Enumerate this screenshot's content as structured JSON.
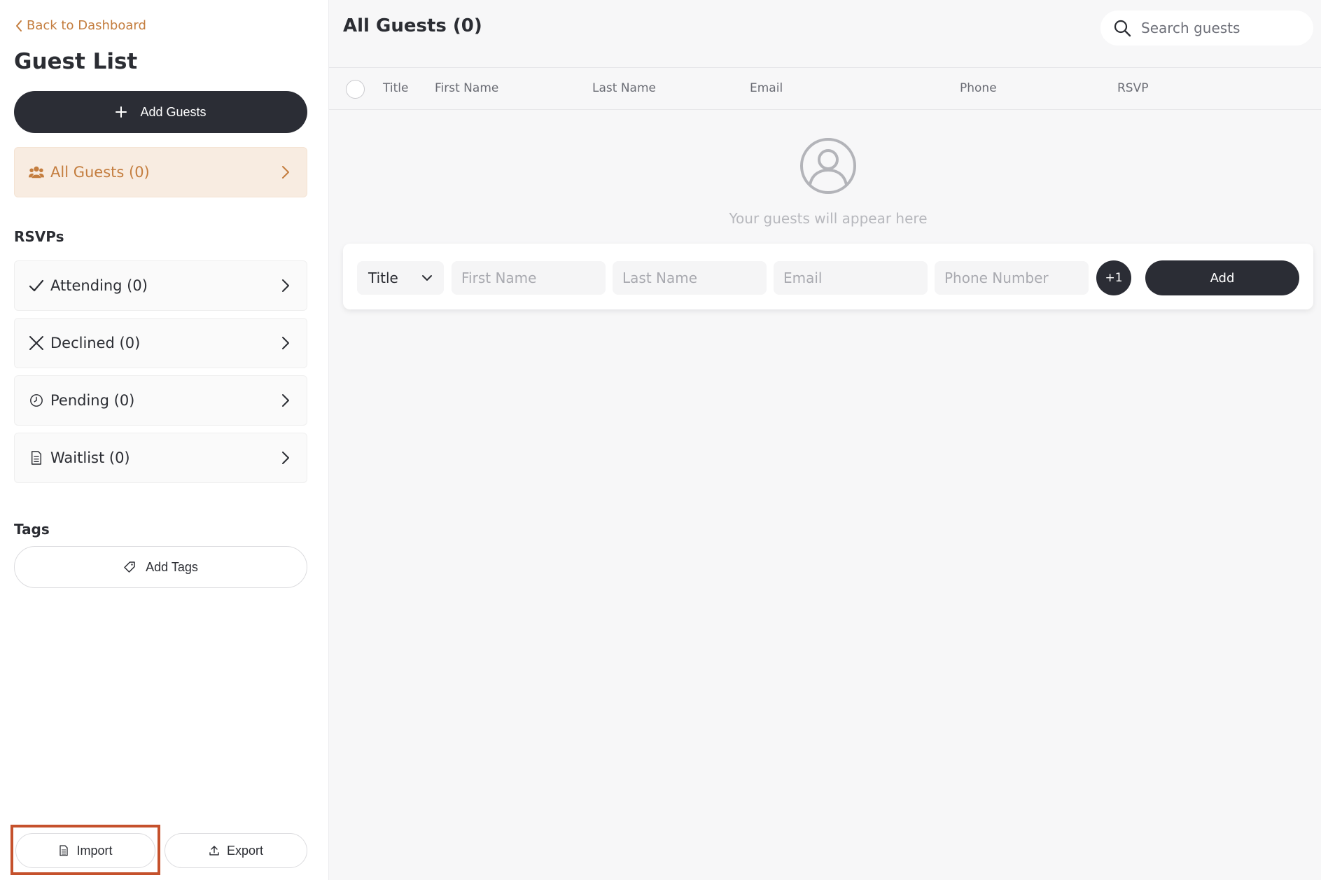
{
  "sidebar": {
    "back_link": "Back to Dashboard",
    "title": "Guest List",
    "add_guests_label": "Add Guests",
    "all_guests_label": "All Guests (0)",
    "rsvps_heading": "RSVPs",
    "rsvp_items": [
      {
        "label": "Attending (0)",
        "icon": "check-icon"
      },
      {
        "label": "Declined (0)",
        "icon": "x-icon"
      },
      {
        "label": "Pending (0)",
        "icon": "clock-icon"
      },
      {
        "label": "Waitlist (0)",
        "icon": "document-icon"
      }
    ],
    "tags_heading": "Tags",
    "add_tags_label": "Add Tags",
    "import_label": "Import",
    "export_label": "Export"
  },
  "main": {
    "title": "All Guests (0)",
    "search_placeholder": "Search guests",
    "columns": [
      "Title",
      "First Name",
      "Last Name",
      "Email",
      "Phone",
      "RSVP"
    ],
    "empty_text": "Your guests will appear here",
    "add_row": {
      "title_value": "Title",
      "first_name_placeholder": "First Name",
      "last_name_placeholder": "Last Name",
      "email_placeholder": "Email",
      "phone_placeholder": "Phone Number",
      "plus_one_label": "+1",
      "add_label": "Add"
    }
  },
  "colors": {
    "accent": "#c47d3e",
    "dark_button": "#2b2d35",
    "active_bg": "#f8ece1",
    "highlight_border": "#c5512c"
  }
}
